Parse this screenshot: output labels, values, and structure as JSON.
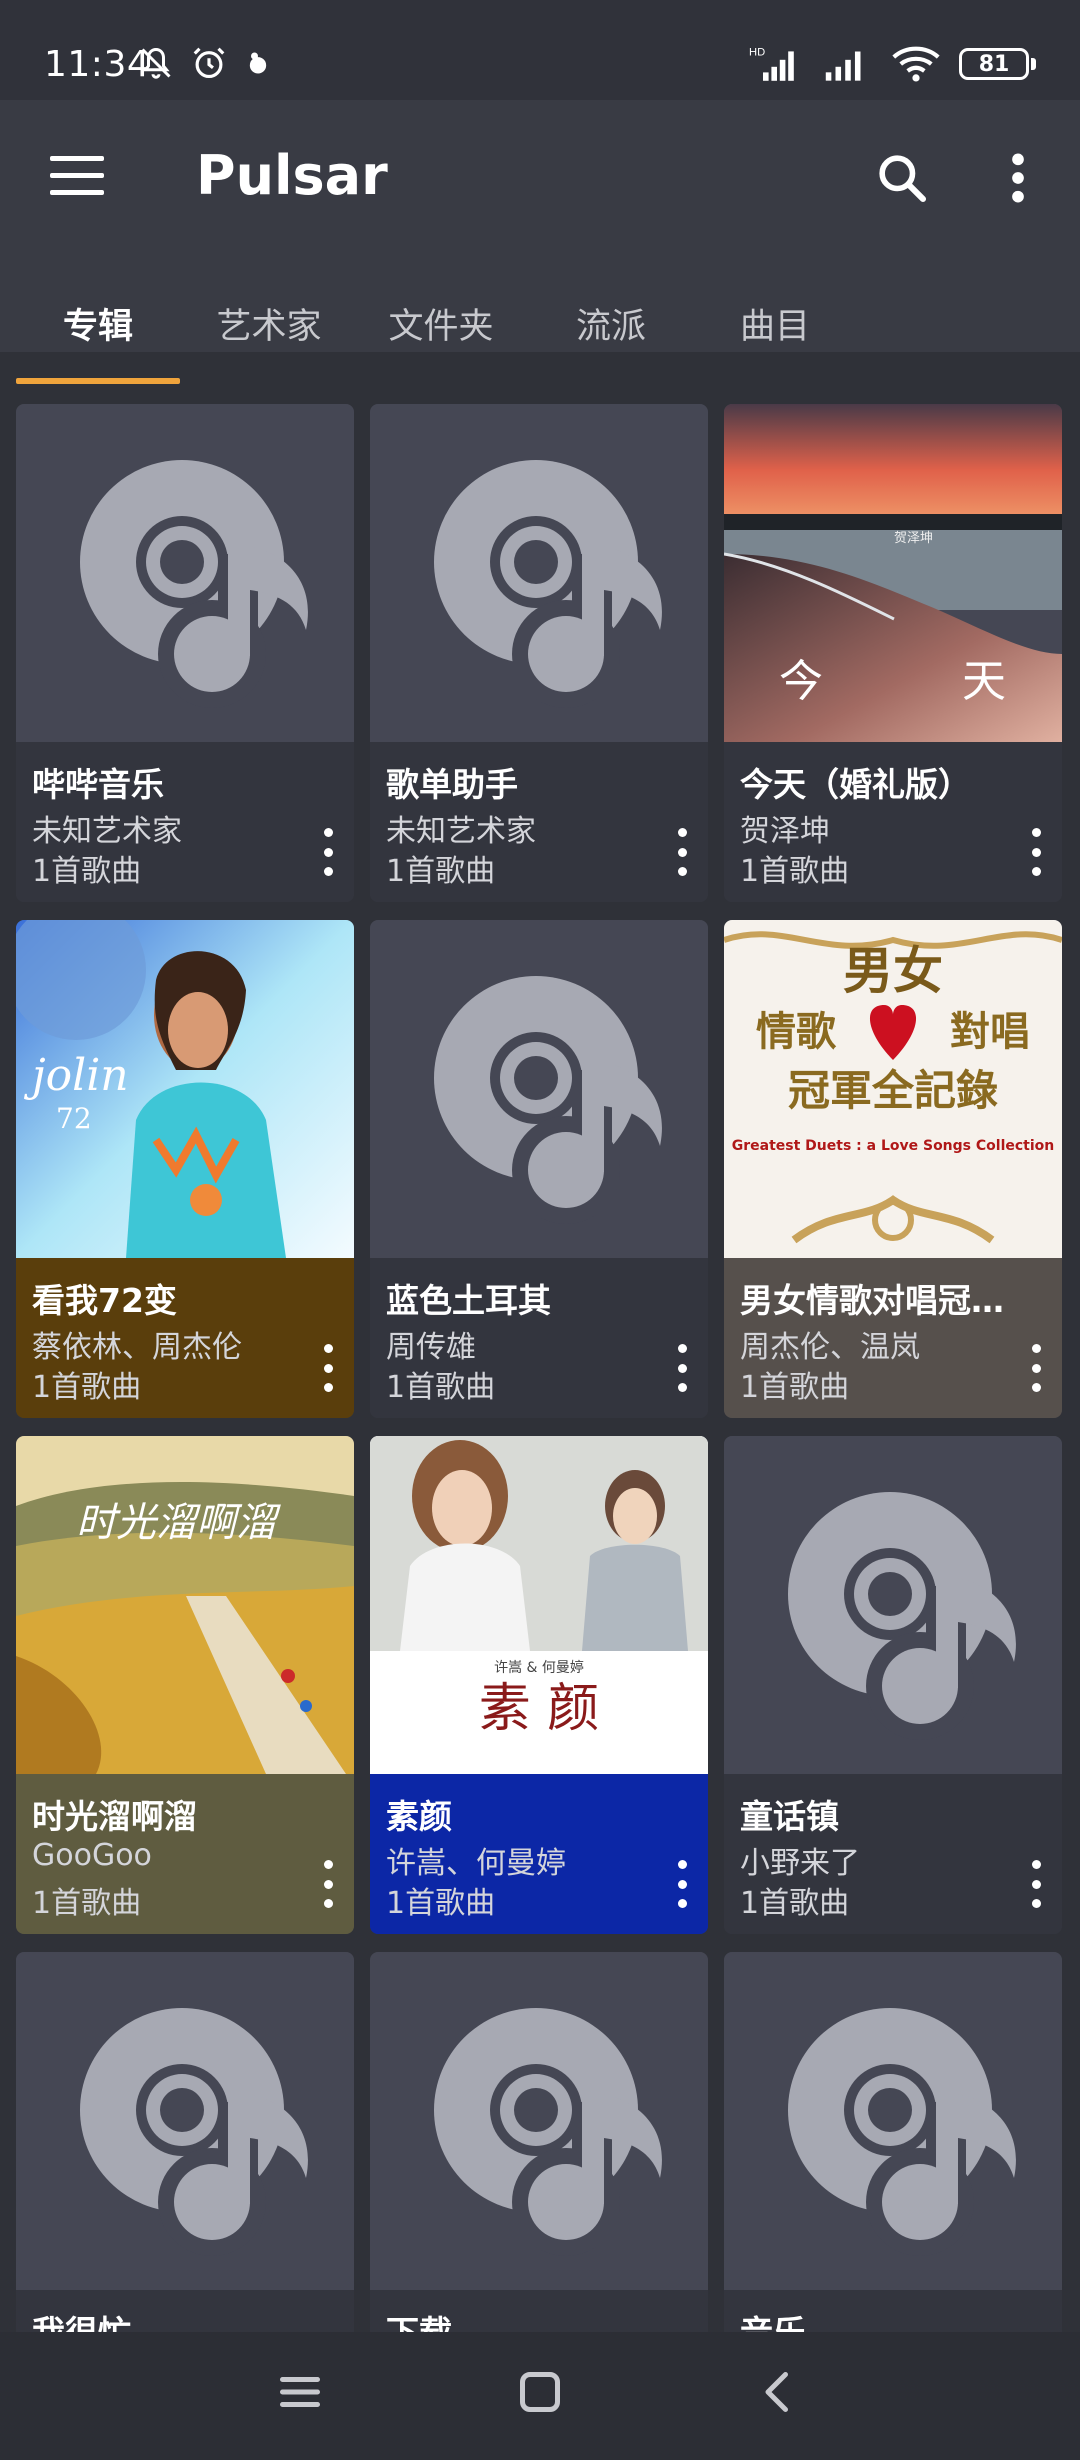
{
  "status_bar": {
    "time": "11:34",
    "battery": "81",
    "network_label": "HD",
    "icons": [
      "bell-off-icon",
      "alarm-icon",
      "app-notification-icon",
      "signal-icon",
      "signal-icon",
      "wifi-icon",
      "battery-icon"
    ]
  },
  "app_bar": {
    "title": "Pulsar",
    "icons": [
      "menu-icon",
      "search-icon",
      "more-vert-icon"
    ]
  },
  "tabs": [
    {
      "label": "专辑",
      "active": true
    },
    {
      "label": "艺术家",
      "active": false
    },
    {
      "label": "文件夹",
      "active": false
    },
    {
      "label": "流派",
      "active": false
    },
    {
      "label": "曲目",
      "active": false
    }
  ],
  "colors": {
    "accent": "#f0a43c",
    "background": "#2f3138",
    "placeholder_cover": "#454754",
    "placeholder_icon": "#a7a9b3"
  },
  "albums": [
    {
      "title": "哔哔音乐",
      "artist": "未知艺术家",
      "count": "1首歌曲",
      "cover": "placeholder",
      "info_color": "#33353e"
    },
    {
      "title": "歌单助手",
      "artist": "未知艺术家",
      "count": "1首歌曲",
      "cover": "placeholder",
      "info_color": "#33353e"
    },
    {
      "title": "今天（婚礼版）",
      "artist": "贺泽坤",
      "count": "1首歌曲",
      "cover": "beach-sunset",
      "info_color": "#33353e"
    },
    {
      "title": "看我72变",
      "artist": "蔡依林、周杰伦",
      "count": "1首歌曲",
      "cover": "jolin-72",
      "info_color": "#5a3e0c"
    },
    {
      "title": "蓝色土耳其",
      "artist": "周传雄",
      "count": "1首歌曲",
      "cover": "placeholder",
      "info_color": "#33353e"
    },
    {
      "title": "男女情歌对唱冠…",
      "artist": "周杰伦、温岚",
      "count": "1首歌曲",
      "cover": "duets-gold",
      "info_color": "#56504c"
    },
    {
      "title": "时光溜啊溜",
      "artist": "GooGoo",
      "count": "1首歌曲",
      "cover": "wheat-field",
      "info_color": "#5f5c40"
    },
    {
      "title": "素颜",
      "artist": "许嵩、何曼婷",
      "count": "1首歌曲",
      "cover": "su-yan",
      "info_color": "#0c27a6"
    },
    {
      "title": "童话镇",
      "artist": "小野来了",
      "count": "1首歌曲",
      "cover": "placeholder",
      "info_color": "#33353e"
    },
    {
      "title": "我很忙",
      "artist": "",
      "count": "",
      "cover": "placeholder",
      "info_color": "#33353e"
    },
    {
      "title": "下载",
      "artist": "",
      "count": "",
      "cover": "placeholder",
      "info_color": "#33353e"
    },
    {
      "title": "音乐",
      "artist": "",
      "count": "",
      "cover": "placeholder",
      "info_color": "#33353e"
    }
  ],
  "cover_art": {
    "beach_text_left": "今",
    "beach_text_right": "天",
    "beach_caption": "贺泽坤",
    "jolin_logo": "jolin",
    "jolin_num": "72",
    "duets_line1": "男女",
    "duets_line2": "情歌",
    "duets_line3": "對唱",
    "duets_line4": "冠軍全記錄",
    "duets_en": "Greatest Duets : a Love Songs Collection",
    "wheat_title": "时光溜啊溜",
    "su_artists": "许嵩 & 何曼婷",
    "su_title": "素 颜"
  },
  "nav_bar": {
    "icons": [
      "recent-apps-icon",
      "home-icon",
      "back-icon"
    ]
  }
}
